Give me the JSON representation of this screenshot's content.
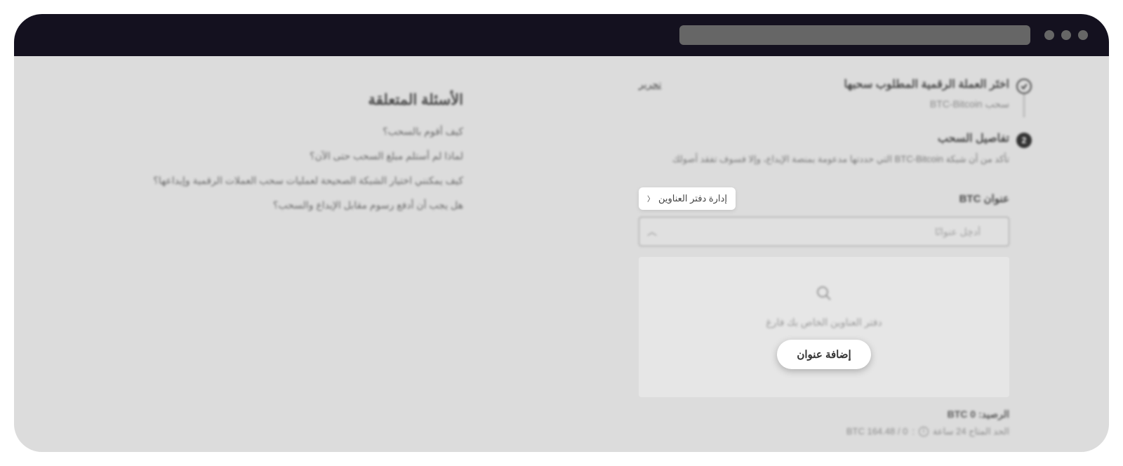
{
  "faq": {
    "title": "الأسئلة المتعلقة",
    "items": [
      "كيف أقوم بالسحب؟",
      "لماذا لم أستلم مبلغ السحب حتى الآن؟",
      "كيف يمكنني اختيار الشبكة الصحيحة لعمليات سحب العملات الرقمية وإيداعها؟",
      "هل يجب أن أدفع رسوم مقابل الإيداع والسحب؟"
    ]
  },
  "step1": {
    "title": "اختَر العملة الرقمية المطلوب سحبها",
    "edit": "تحرير",
    "sub": "سحب BTC-Bitcoin"
  },
  "step2": {
    "num": "2",
    "title": "تفاصيل السحب",
    "desc": "تأكد من أن شبكة BTC-Bitcoin التي حددتها مدعومة بمنصة الإيداع، وإلا فسوف تفقد أصولك",
    "field_label": "عنوان BTC",
    "manage": "إدارة دفتر العناوين",
    "placeholder": "أدخِل عنوانًا",
    "empty": "دفتر العناوين الخاص بك فارغ",
    "add_btn": "إضافة عنوان",
    "balance_label": "الرصيد:",
    "balance_value": "0 BTC",
    "limit_label": "الحد المتاح 24 ساعة",
    "limit_value": "0 / 164.48 BTC"
  }
}
